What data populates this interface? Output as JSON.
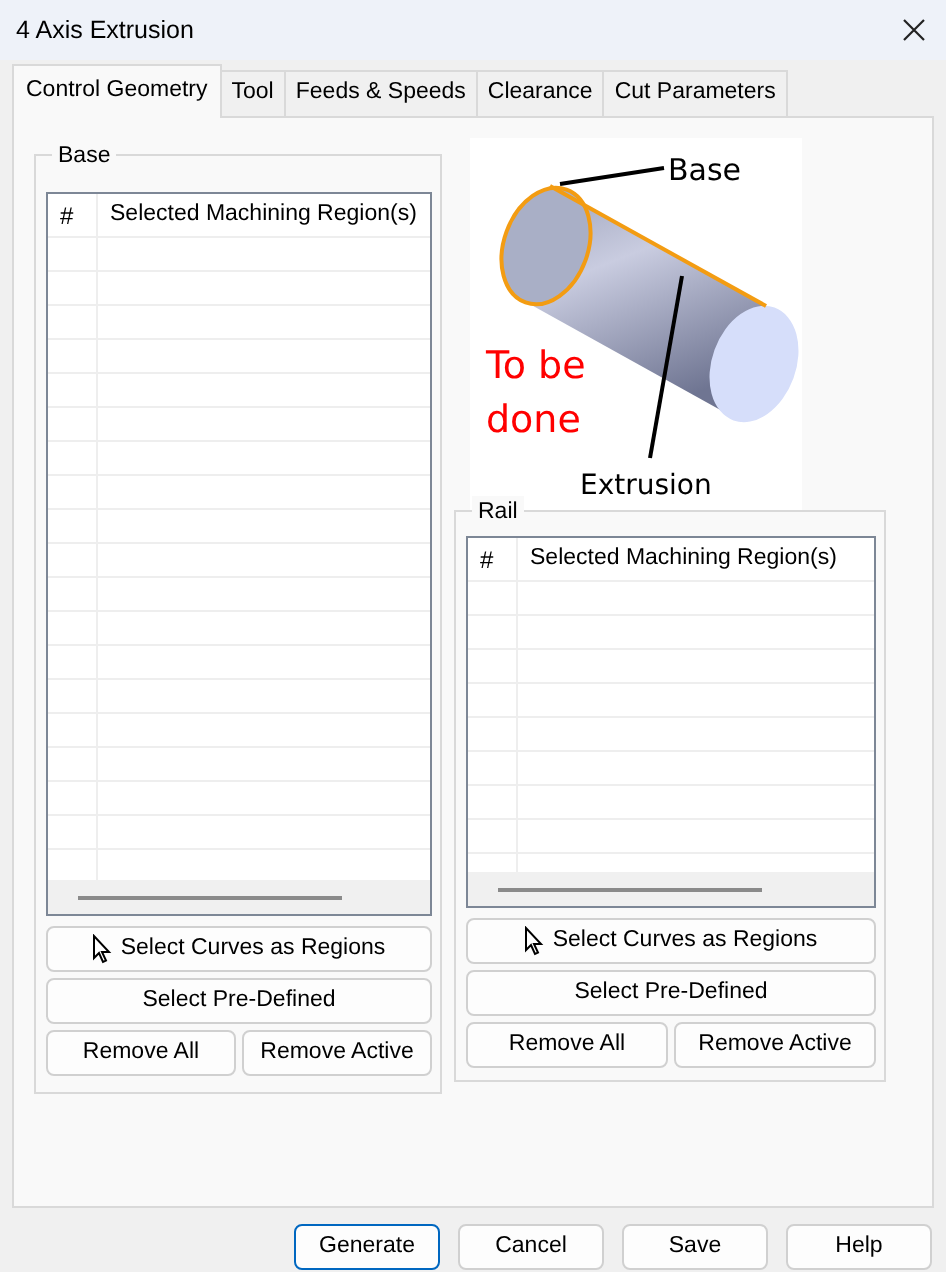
{
  "window": {
    "title": "4 Axis Extrusion"
  },
  "tabs": [
    {
      "label": "Control Geometry",
      "selected": true
    },
    {
      "label": "Tool",
      "selected": false
    },
    {
      "label": "Feeds & Speeds",
      "selected": false
    },
    {
      "label": "Clearance",
      "selected": false
    },
    {
      "label": "Cut Parameters",
      "selected": false
    }
  ],
  "groups": [
    {
      "legend": "Base",
      "columns": [
        "#",
        "Selected Machining Region(s)"
      ],
      "select_curves": "Select Curves as Regions",
      "select_predefined": "Select Pre-Defined",
      "remove_all": "Remove All",
      "remove_active": "Remove Active"
    },
    {
      "legend": "Rail",
      "columns": [
        "#",
        "Selected Machining Region(s)"
      ],
      "select_curves": "Select Curves as Regions",
      "select_predefined": "Select Pre-Defined",
      "remove_all": "Remove All",
      "remove_active": "Remove Active"
    }
  ],
  "diagram": {
    "base_label": "Base",
    "extrusion_label": "Extrusion",
    "note": [
      "To be",
      "done"
    ]
  },
  "footer_buttons": [
    {
      "label": "Generate",
      "default": true
    },
    {
      "label": "Cancel",
      "default": false
    },
    {
      "label": "Save",
      "default": false
    },
    {
      "label": "Help",
      "default": false
    }
  ]
}
